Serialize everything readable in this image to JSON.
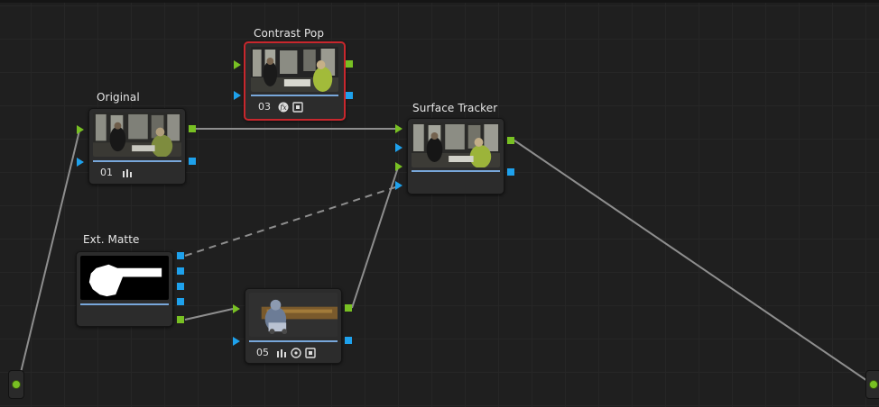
{
  "nodes": {
    "original": {
      "title": "Original",
      "number": "01"
    },
    "contrast_pop": {
      "title": "Contrast Pop",
      "number": "03"
    },
    "surface_tracker": {
      "title": "Surface Tracker"
    },
    "ext_matte": {
      "title": "Ext. Matte"
    },
    "node05": {
      "number": "05"
    }
  },
  "colors": {
    "background": "#1f1f1f",
    "rgb_port": "#78c023",
    "key_port": "#1ea1ec",
    "selected_outline": "#c8272d",
    "wire": "#9a9a9a"
  },
  "icons": [
    "curves-icon",
    "fx-icon",
    "tracker-icon",
    "window-circle-icon"
  ]
}
